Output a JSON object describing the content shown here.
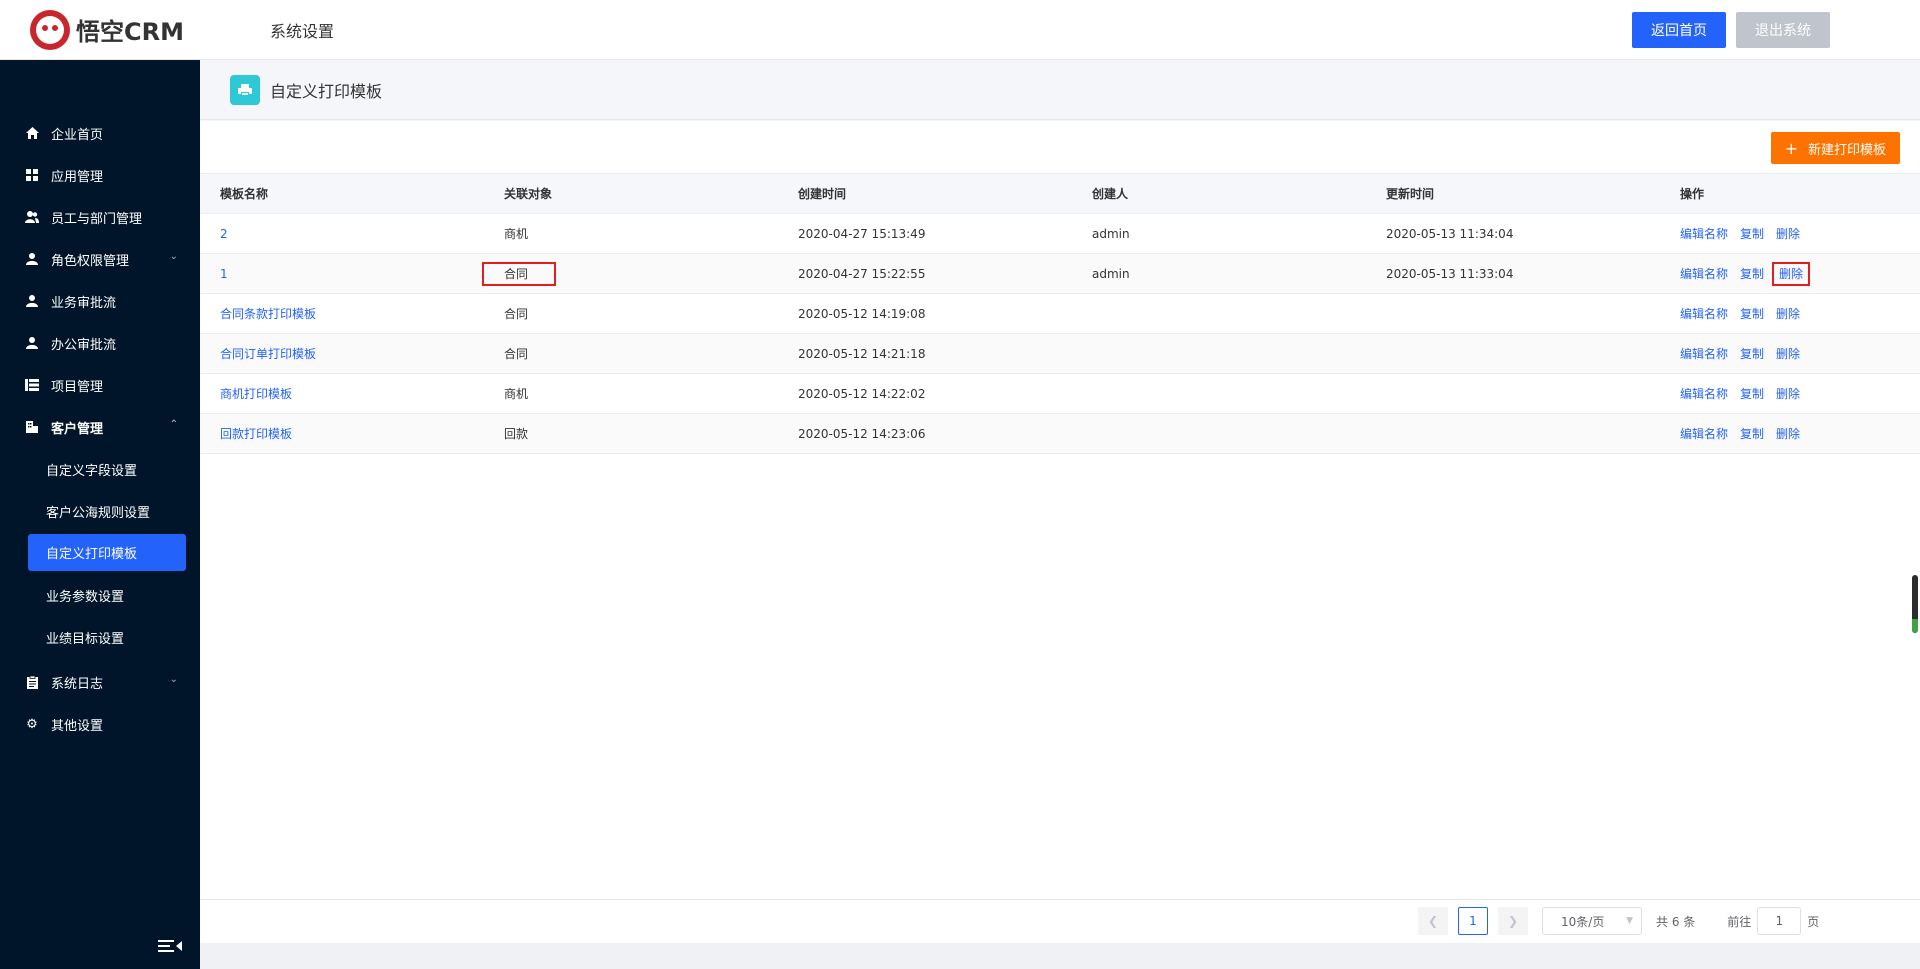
{
  "header": {
    "logo_text": "悟空CRM",
    "section_title": "系统设置",
    "home_button": "返回首页",
    "logout_button": "退出系统"
  },
  "sidebar": {
    "items": [
      {
        "label": "企业首页",
        "icon": "home-icon"
      },
      {
        "label": "应用管理",
        "icon": "grid-icon"
      },
      {
        "label": "员工与部门管理",
        "icon": "users-icon"
      },
      {
        "label": "角色权限管理",
        "icon": "user-icon",
        "has_arrow": true
      },
      {
        "label": "业务审批流",
        "icon": "user-icon"
      },
      {
        "label": "办公审批流",
        "icon": "user-icon"
      },
      {
        "label": "项目管理",
        "icon": "list-icon"
      },
      {
        "label": "客户管理",
        "icon": "building-icon",
        "open": true
      }
    ],
    "customer_submenu": [
      {
        "label": "自定义字段设置"
      },
      {
        "label": "客户公海规则设置"
      },
      {
        "label": "自定义打印模板",
        "active": true
      },
      {
        "label": "业务参数设置"
      },
      {
        "label": "业绩目标设置"
      }
    ],
    "bottom_items": [
      {
        "label": "系统日志",
        "icon": "clipboard-icon",
        "has_arrow": true
      },
      {
        "label": "其他设置",
        "icon": "gear-icon"
      }
    ]
  },
  "page": {
    "title": "自定义打印模板",
    "new_button": "新建打印模板"
  },
  "table": {
    "columns": [
      "模板名称",
      "关联对象",
      "创建时间",
      "创建人",
      "更新时间",
      "操作"
    ],
    "rows": [
      {
        "name": "2",
        "object": "商机",
        "created": "2020-04-27 15:13:49",
        "creator": "admin",
        "updated": "2020-05-13 11:34:04"
      },
      {
        "name": "1",
        "object": "合同",
        "created": "2020-04-27 15:22:55",
        "creator": "admin",
        "updated": "2020-05-13 11:33:04"
      },
      {
        "name": "合同条款打印模板",
        "object": "合同",
        "created": "2020-05-12 14:19:08",
        "creator": "",
        "updated": ""
      },
      {
        "name": "合同订单打印模板",
        "object": "合同",
        "created": "2020-05-12 14:21:18",
        "creator": "",
        "updated": ""
      },
      {
        "name": "商机打印模板",
        "object": "商机",
        "created": "2020-05-12 14:22:02",
        "creator": "",
        "updated": ""
      },
      {
        "name": "回款打印模板",
        "object": "回款",
        "created": "2020-05-12 14:23:06",
        "creator": "",
        "updated": ""
      }
    ],
    "ops": {
      "edit": "编辑名称",
      "copy": "复制",
      "delete": "删除"
    }
  },
  "pagination": {
    "current_page": "1",
    "page_size": "10条/页",
    "total": "共 6 条",
    "goto_label": "前往",
    "goto_value": "1",
    "page_suffix": "页"
  },
  "colors": {
    "primary": "#2362fb",
    "sidebar_bg": "#001529",
    "orange": "#fe7300",
    "highlight_red": "#e02020"
  }
}
